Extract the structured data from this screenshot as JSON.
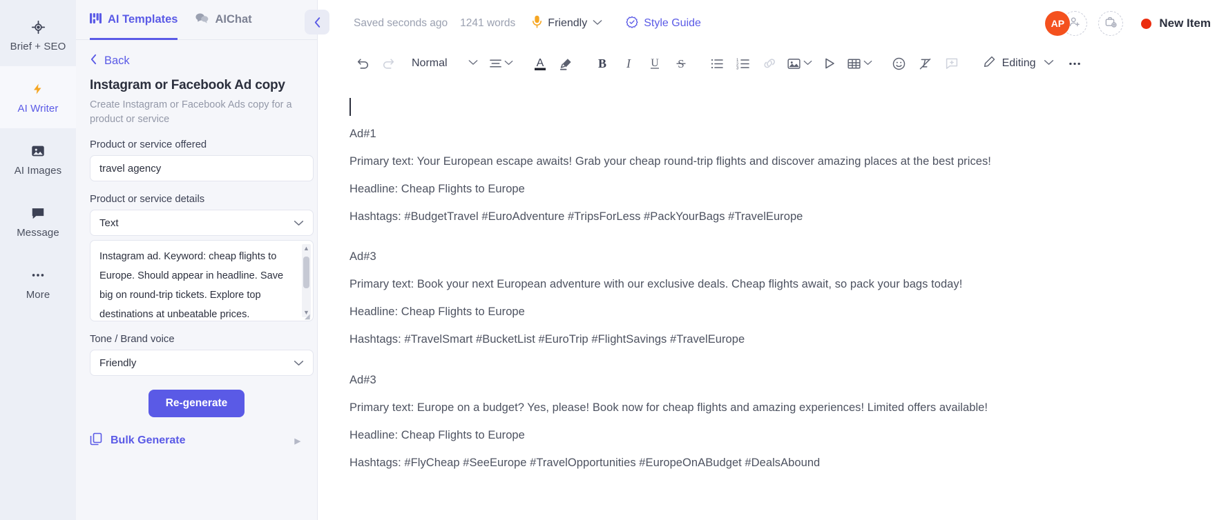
{
  "rail": {
    "items": [
      {
        "label": "Brief + SEO",
        "icon": "target-icon",
        "active": false
      },
      {
        "label": "AI Writer",
        "icon": "lightning-bolt-icon",
        "active": true
      },
      {
        "label": "AI Images",
        "icon": "image-icon",
        "active": false
      },
      {
        "label": "Message",
        "icon": "chat-bubble-icon",
        "active": false
      },
      {
        "label": "More",
        "icon": "ellipsis-icon",
        "active": false
      }
    ]
  },
  "panel": {
    "tabs": [
      {
        "label": "AI Templates",
        "icon": "grid-templates-icon",
        "active": true
      },
      {
        "label": "AIChat",
        "icon": "chat-bubbles-icon",
        "active": false
      }
    ],
    "back_label": "Back",
    "template_title": "Instagram or Facebook Ad copy",
    "template_subtitle": "Create Instagram or Facebook Ads copy for a product or service",
    "fields": {
      "product_label": "Product or service offered",
      "product_value": "travel agency",
      "details_label": "Product or service details",
      "details_select_value": "Text",
      "details_textarea_value": "Instagram ad. Keyword: cheap flights to Europe. Should appear in headline. Save big on round-trip tickets. Explore top destinations at unbeatable prices.",
      "tone_label": "Tone / Brand voice",
      "tone_value": "Friendly"
    },
    "regenerate_label": "Re-generate",
    "bulk_label": "Bulk Generate",
    "collapse_icon": "chevron-left-icon"
  },
  "editor": {
    "header": {
      "saved_status": "Saved seconds ago",
      "word_count": "1241 words",
      "tone_value": "Friendly",
      "tone_icon": "microphone-icon",
      "style_guide_label": "Style Guide",
      "style_guide_icon": "verified-badge-icon",
      "avatar_initials": "AP",
      "add_person_icon": "add-person-icon",
      "add_project_icon": "add-briefcase-icon",
      "new_item_label": "New Item",
      "new_item_dot_color": "#eb2d0f"
    },
    "toolbar": {
      "undo": "undo-icon",
      "redo": "redo-icon",
      "style_value": "Normal",
      "align": "align-left-icon",
      "text_color": "text-color-icon",
      "highlight": "highlighter-icon",
      "bold": "bold-icon",
      "italic": "italic-icon",
      "underline": "underline-icon",
      "strikethrough": "strikethrough-icon",
      "bullet_list": "bullet-list-icon",
      "numbered_list": "numbered-list-icon",
      "link": "link-icon",
      "image": "image-icon",
      "media": "play-triangle-icon",
      "table": "table-icon",
      "emoji": "emoji-smiley-icon",
      "clear_format": "clear-formatting-icon",
      "comment": "add-comment-icon",
      "mode_label": "Editing",
      "mode_icon": "pencil-icon",
      "more": "ellipsis-icon"
    },
    "document": {
      "blocks": [
        {
          "title": "Ad#1",
          "primary": "Primary text: Your European escape awaits! Grab your cheap round-trip flights and discover amazing places at the best prices!",
          "headline": "Headline: Cheap Flights to Europe",
          "hashtags": "Hashtags: #BudgetTravel #EuroAdventure #TripsForLess #PackYourBags #TravelEurope"
        },
        {
          "title": "Ad#3",
          "primary": "Primary text: Book your next European adventure with our exclusive deals. Cheap flights await, so pack your bags today!",
          "headline": "Headline: Cheap Flights to Europe",
          "hashtags": "Hashtags: #TravelSmart #BucketList #EuroTrip #FlightSavings #TravelEurope"
        },
        {
          "title": "Ad#3",
          "primary": "Primary text: Europe on a budget? Yes, please! Book now for cheap flights and amazing experiences! Limited offers available!",
          "headline": "Headline: Cheap Flights to Europe",
          "hashtags": "Hashtags: #FlyCheap #SeeEurope #TravelOpportunities #EuropeOnABudget #DealsAbound"
        }
      ]
    }
  },
  "colors": {
    "accent": "#5a5ae6",
    "avatar": "#f4511e",
    "new_item_dot": "#eb2d0f"
  }
}
